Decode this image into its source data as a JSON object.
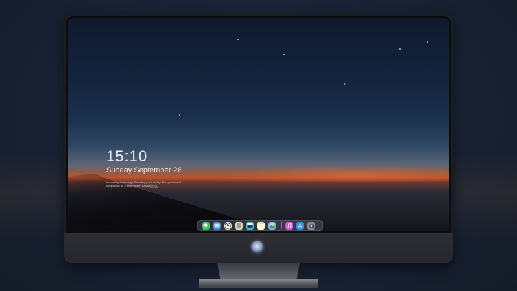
{
  "lock_screen": {
    "time": "15:10",
    "date": "Sunday September 28",
    "tagline": "Innovating technology, Elevating productivity. Mac, your ideal companion for a smarter life. Based自由定"
  },
  "dock": {
    "apps": [
      {
        "name": "messages-icon",
        "color": "#3cc45a"
      },
      {
        "name": "finder-icon",
        "color": "#3b8de6"
      },
      {
        "name": "clock-icon",
        "color": "#f4f4f4"
      },
      {
        "name": "preview-icon",
        "color": "#e8d38a"
      },
      {
        "name": "clapperboard-icon",
        "color": "#4ab7d8"
      },
      {
        "name": "notes-icon",
        "color": "#f6d74d"
      },
      {
        "name": "photos-icon",
        "color": "#7fb3e8"
      },
      {
        "name": "itunes-icon",
        "color": "#d650d6"
      },
      {
        "name": "app-store-icon",
        "color": "#2f8ef2"
      },
      {
        "name": "camera-icon",
        "color": "#8b8d93"
      }
    ]
  },
  "colors": {
    "accent": "#c2502b",
    "sky_top": "#0f1a2e",
    "bezel": "#1b1d22"
  }
}
